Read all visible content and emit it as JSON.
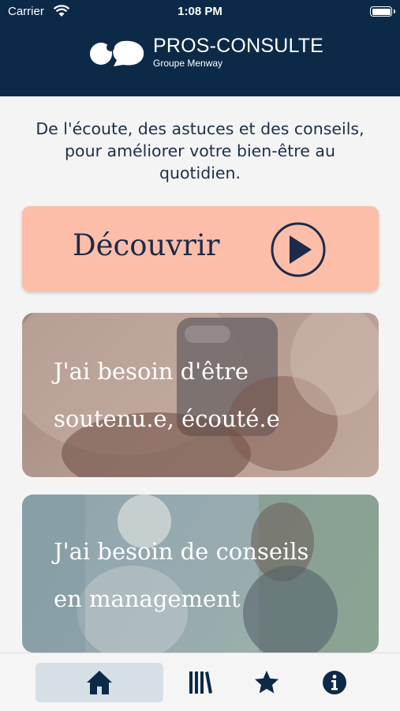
{
  "status_bar": {
    "carrier": "Carrier",
    "time": "1:08 PM"
  },
  "header": {
    "brand": "PROS-CONSULTE",
    "subtitle": "Groupe Menway"
  },
  "tagline": "De l'écoute, des astuces et des conseils, pour améliorer votre bien-être au quotidien.",
  "discover": {
    "label": "Découvrir",
    "icon": "play-circle-icon"
  },
  "cards": [
    {
      "line1": "J'ai besoin d'être",
      "line2": "soutenu.e, écouté.e"
    },
    {
      "line1": "J'ai besoin de conseils",
      "line2": "en management"
    }
  ],
  "tabbar": {
    "items": [
      {
        "icon": "home-icon",
        "active": true
      },
      {
        "icon": "library-icon",
        "active": false
      },
      {
        "icon": "star-icon",
        "active": false
      },
      {
        "icon": "info-icon",
        "active": false
      }
    ]
  },
  "colors": {
    "header": "#0c2a48",
    "discover_bg": "#fcbea9",
    "text_dark": "#1d2a4a",
    "tab_active_bg": "#d6dfe6",
    "icon": "#0c2a48"
  }
}
